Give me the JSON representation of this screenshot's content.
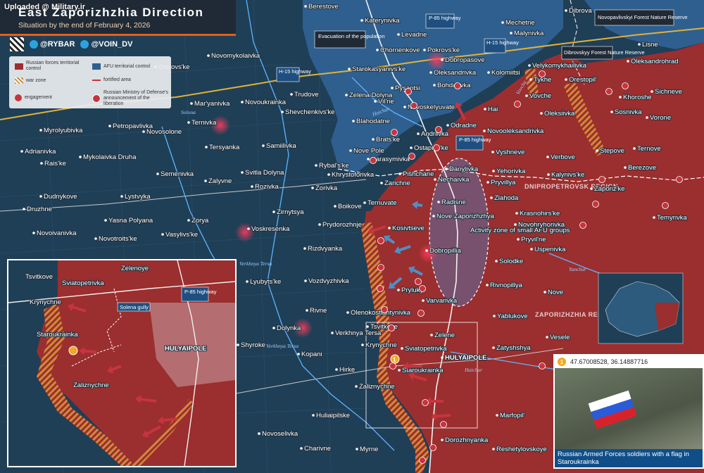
{
  "watermark": "Uploaded @ Military.ir",
  "title": "East Zaporizhzhia Direction",
  "subtitle": "Situation by the end of February 4, 2026",
  "socials": [
    {
      "icon": "telegram-icon",
      "handle": "@RYBAR"
    },
    {
      "icon": "telegram-icon",
      "handle": "@VOIN_DV"
    }
  ],
  "legend": {
    "russian_control": "Russian forces territorial control",
    "afu_control": "AFU territorial control",
    "war_zone": "war zone",
    "fortified_area": "fortified area",
    "engagement": "engagement",
    "liberation": "Russian Ministry of Defense's announcement of the liberation"
  },
  "colors": {
    "russian": "#9b2e2e",
    "afu": "#2f5f8f",
    "grayzone": "#1f3f57",
    "war_zone": "#d08a3a",
    "accent": "#e4601a"
  },
  "callouts": {
    "evacuation": "Evacuation of the population",
    "activity_zone": "Activity zone of small AFU groups",
    "forest_reserve": "Novopavlivskyi Forest Nature Reserve",
    "dibrovsky": "Dibrovskyy Forest Nature Reserve",
    "p85_top": "P-85 highway",
    "p85_mid": "P-85 highway",
    "h15": "H-15 highway",
    "h15_b": "H-15 highway"
  },
  "regions": {
    "dnipro": "DNIPROPETROVSK REGION",
    "zap": "ZAPORIZHZHIA REGION"
  },
  "towns": [
    "Berestove",
    "Katerynivka",
    "Dibrova",
    "Mechetne",
    "Malynivka",
    "Levadne",
    "Chornenkove",
    "Pokrovs'ke",
    "Dobropasove",
    "Starokasyanivs'ke",
    "Oleksandrivka",
    "Kolomiitsi",
    "Velykomykhailivka",
    "Novoselivka",
    "Oleksandrohrad",
    "Lisne",
    "Novomykolaivka",
    "Ostrovs'ke",
    "Trudove",
    "Pysantsi",
    "Bohdarivka",
    "Tykhe",
    "Orestopil'",
    "Khoroshe",
    "Sichneve",
    "Mar'yanivka",
    "Novoukrainka",
    "Zelena Dolyna",
    "Vil'ne",
    "Novoskelyuvate",
    "Hai",
    "Vovche",
    "Oleksiivka",
    "Sosnivka",
    "Vorone",
    "Myrolyubivka",
    "Petropavlivka",
    "Shevchenkivs'ke",
    "Blahodatne",
    "Odradne",
    "Andriivka",
    "Novooleksandrivka",
    "Ternivka",
    "Novosolone",
    "Samiilivka",
    "Brats'ke",
    "Ostapivs'ke",
    "Vyshneve",
    "Verbove",
    "Stepove",
    "Ternove",
    "Tersyanka",
    "Adrianivka",
    "Mykolaivka Druha",
    "Nove Pole",
    "Harasymivka",
    "Danylivka",
    "Yehorivka",
    "Kalynivs'ke",
    "Berezove",
    "Rais'ke",
    "Semenivka",
    "Svitla Dolyna",
    "Rybal's'ke",
    "Khrystoforivka",
    "Pishchane",
    "Nechaivka",
    "Pryvillya",
    "Zaporiz'ke",
    "Dudnykove",
    "Zalyvne",
    "Rozivka",
    "Zorivka",
    "Zarichne",
    "Lystvyka",
    "Boikove",
    "Ternuvate",
    "Radisne",
    "Zlahoda",
    "Druzhne",
    "Zirnytsya",
    "Krasnohirs'ke",
    "Yasna Polyana",
    "Zorya",
    "Nove Zaporizhzhya",
    "Novohryhorivka",
    "Temyrivka",
    "Novoivanivka",
    "Novotroits'ke",
    "Vasylivs'ke",
    "Voskresenka",
    "Prydorozhnje",
    "Kosivtseve",
    "Pryvil'ne",
    "Uspenivka",
    "Rizdvyanka",
    "Dobropillia",
    "Solodke",
    "Lyubyts'ke",
    "Vozdvyzhivka",
    "Pryluky",
    "Rivnopillya",
    "Nove",
    "Varvarivka",
    "Rivne",
    "Olenokostiantynivka",
    "Yablukove",
    "Dolynka",
    "Verkhnya Tersa",
    "Tsvitkove",
    "Zelene",
    "Shyroke",
    "Kopani",
    "Krynychne",
    "Sviatopetrivka",
    "Zatyshshya",
    "Vesele",
    "Hirke",
    "Staroukrainka",
    "HULYAIPOLE",
    "Zaliznychne",
    "Huliaipilske",
    "Marfopil'",
    "Novoselivka",
    "Charivne",
    "Myrne",
    "Dorozhnyanka",
    "Reshetylovskoye",
    "Zelenoye"
  ],
  "inset_towns": [
    "Tsvitkove",
    "Zelenoye",
    "Sviatopetrivka",
    "Krynychne",
    "Staroukrainka",
    "Zaliznychne",
    "HULYAIPOLE"
  ],
  "inset_callouts": {
    "gully": "Solena gully",
    "p85": "P-85 highway"
  },
  "rivers": [
    "Haichur",
    "Vovcha",
    "Solona",
    "Verkhnya Tersa",
    "Verkhnya Tersa",
    "Yanchur",
    "Haichur"
  ],
  "photo": {
    "coords": "47.67008528, 36.14887716",
    "marker": "1",
    "caption": "Russian Armed Forces soldiers with a flag in Staroukrainka"
  },
  "markers": {
    "staroukrainka": "1"
  }
}
